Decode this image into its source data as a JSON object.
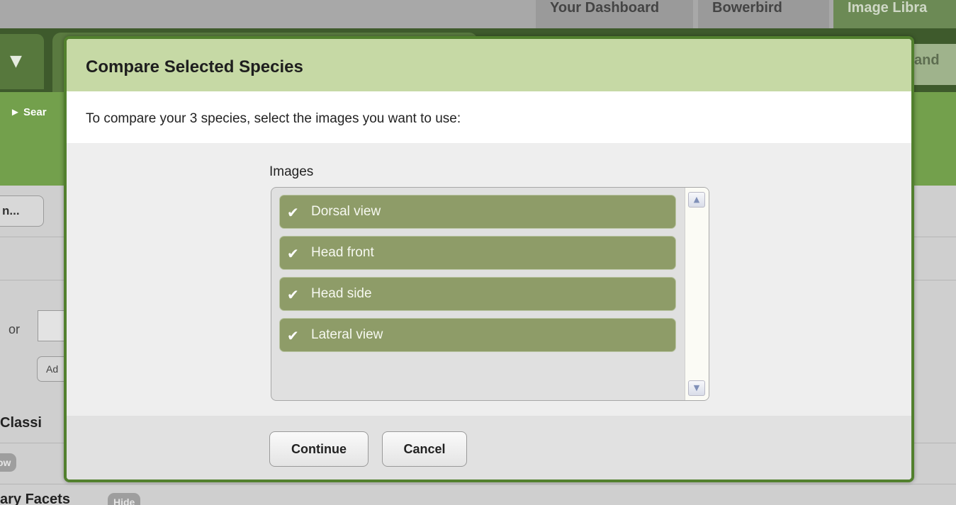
{
  "background": {
    "tabs": [
      "Your Dashboard",
      "Bowerbird",
      "Image Libra"
    ],
    "nav_left_arrow": "▼",
    "nav_right_text": "and",
    "breadcrumb": "► Sear",
    "button_truncated": "n...",
    "or_label": "or",
    "add_button": "Ad",
    "classification_heading": "Classi",
    "show_pill": "ow",
    "facets_heading": "ary Facets",
    "hide_pill": "Hide"
  },
  "modal": {
    "title": "Compare Selected Species",
    "instruction": "To compare your 3 species, select the images you want to use:",
    "images_label": "Images",
    "images": [
      {
        "label": "Dorsal view",
        "checked": true,
        "check_icon": "checkmark-icon"
      },
      {
        "label": "Head front",
        "checked": true,
        "check_icon": "checkmark-icon"
      },
      {
        "label": "Head side",
        "checked": true,
        "check_icon": "checkmark-icon"
      },
      {
        "label": "Lateral view",
        "checked": true,
        "check_icon": "checkmark-icon"
      }
    ],
    "buttons": {
      "continue": "Continue",
      "cancel": "Cancel"
    }
  },
  "colors": {
    "header_green": "#c6d9a5",
    "border_green": "#52802e",
    "item_green": "#8e9c68"
  }
}
